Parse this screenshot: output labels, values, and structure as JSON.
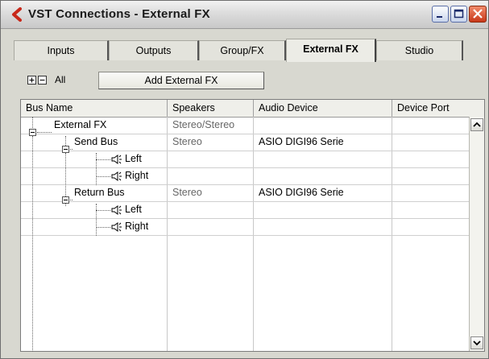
{
  "window": {
    "title": "VST Connections - External FX"
  },
  "tabs": [
    {
      "label": "Inputs"
    },
    {
      "label": "Outputs"
    },
    {
      "label": "Group/FX"
    },
    {
      "label": "External FX"
    },
    {
      "label": "Studio"
    }
  ],
  "toolbar": {
    "all_label": "All",
    "add_button_label": "Add External FX"
  },
  "table": {
    "columns": [
      "Bus Name",
      "Speakers",
      "Audio Device",
      "Device Port"
    ],
    "rows": [
      {
        "name": "External FX",
        "speakers": "Stereo/Stereo",
        "audio_device": "",
        "device_port": ""
      },
      {
        "name": "Send Bus",
        "speakers": "Stereo",
        "audio_device": "ASIO DIGI96 Serie",
        "device_port": ""
      },
      {
        "name": "Left",
        "speakers": "",
        "audio_device": "",
        "device_port": ""
      },
      {
        "name": "Right",
        "speakers": "",
        "audio_device": "",
        "device_port": ""
      },
      {
        "name": "Return Bus",
        "speakers": "Stereo",
        "audio_device": "ASIO DIGI96 Serie",
        "device_port": ""
      },
      {
        "name": "Left",
        "speakers": "",
        "audio_device": "",
        "device_port": ""
      },
      {
        "name": "Right",
        "speakers": "",
        "audio_device": "",
        "device_port": ""
      }
    ]
  },
  "colors": {
    "app_icon": "#c8281a",
    "window_bg": "#d8d8d0"
  }
}
